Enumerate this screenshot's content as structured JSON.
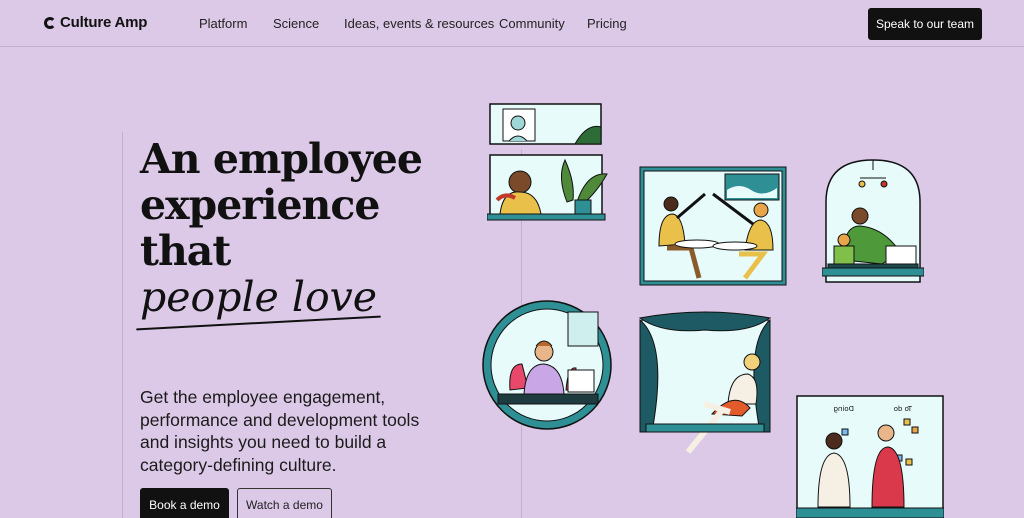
{
  "brand": {
    "name": "Culture Amp"
  },
  "nav": {
    "items": [
      {
        "label": "Platform"
      },
      {
        "label": "Science"
      },
      {
        "label": "Ideas, events & resources"
      },
      {
        "label": "Community"
      },
      {
        "label": "Pricing"
      }
    ],
    "cta": "Speak to our team"
  },
  "hero": {
    "headline_line1": "An employee",
    "headline_line2": "experience",
    "headline_line3_prefix": "that ",
    "headline_line3_script": "people love",
    "subtext": "Get the employee engagement, performance and development tools and insights you need to build a category-defining culture.",
    "primary_cta": "Book a demo",
    "secondary_cta": "Watch a demo"
  },
  "illustrations": {
    "whiteboard_left_label": "Doing",
    "whiteboard_right_label": "To do"
  },
  "colors": {
    "background": "#dcc9e8",
    "teal": "#2e8f95",
    "light_cyan": "#e7fbfb",
    "dark": "#111111"
  }
}
